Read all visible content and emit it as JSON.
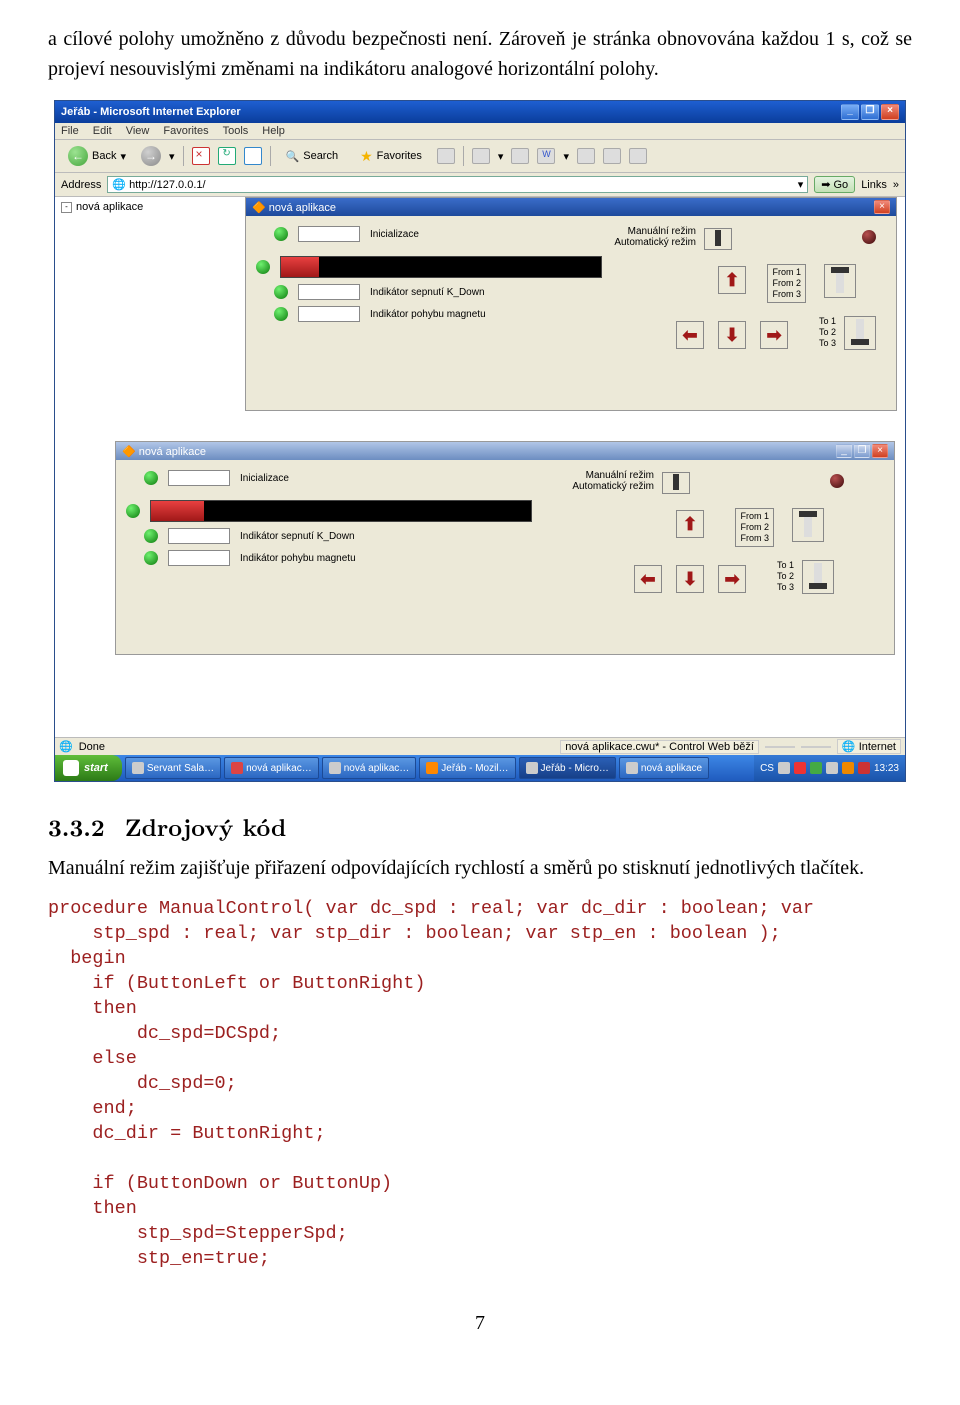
{
  "intro_para": "a cílové polohy umožněno z důvodu bezpečnosti není. Zároveň je stránka obnovována každou 1 s, což se projeví nesouvislými změnami na indikátoru analogové horizontální polohy.",
  "ie": {
    "title": "Jeřáb - Microsoft Internet Explorer",
    "menu": [
      "File",
      "Edit",
      "View",
      "Favorites",
      "Tools",
      "Help"
    ],
    "back": "Back",
    "search": "Search",
    "favorites": "Favorites",
    "w_btn": "W",
    "address_label": "Address",
    "address_value": "http://127.0.0.1/",
    "go": "Go",
    "links": "Links",
    "side_tab": "nová aplikace",
    "status_done": "Done",
    "status_mid": "nová aplikace.cwu* - Control Web běží",
    "status_internet": "Internet"
  },
  "panel": {
    "title": "nová aplikace",
    "init": "Inicializace",
    "man": "Manuální režim",
    "auto": "Automatický režim",
    "kdown": "Indikátor sepnutí K_Down",
    "move": "Indikátor pohybu magnetu",
    "from": [
      "From 1",
      "From 2",
      "From 3"
    ],
    "to": [
      "To 1",
      "To 2",
      "To 3"
    ]
  },
  "taskbar": {
    "start": "start",
    "items": [
      "Servant Sala…",
      "nová aplikac…",
      "nová aplikac…",
      "Jeřáb - Mozil…",
      "Jeřáb - Micro…",
      "nová aplikace"
    ],
    "lang": "CS",
    "time": "13:23"
  },
  "section": {
    "num": "3.3.2",
    "title": "Zdrojový kód"
  },
  "section_para": "Manuální režim zajišťuje přiřazení odpovídajících rychlostí a směrů po stisknutí jednotlivých tlačítek.",
  "code": "procedure ManualControl( var dc_spd : real; var dc_dir : boolean; var\n    stp_spd : real; var stp_dir : boolean; var stp_en : boolean );\n  begin\n    if (ButtonLeft or ButtonRight)\n    then\n        dc_spd=DCSpd;\n    else\n        dc_spd=0;\n    end;\n    dc_dir = ButtonRight;\n\n    if (ButtonDown or ButtonUp)\n    then\n        stp_spd=StepperSpd;\n        stp_en=true;",
  "pagenum": "7"
}
